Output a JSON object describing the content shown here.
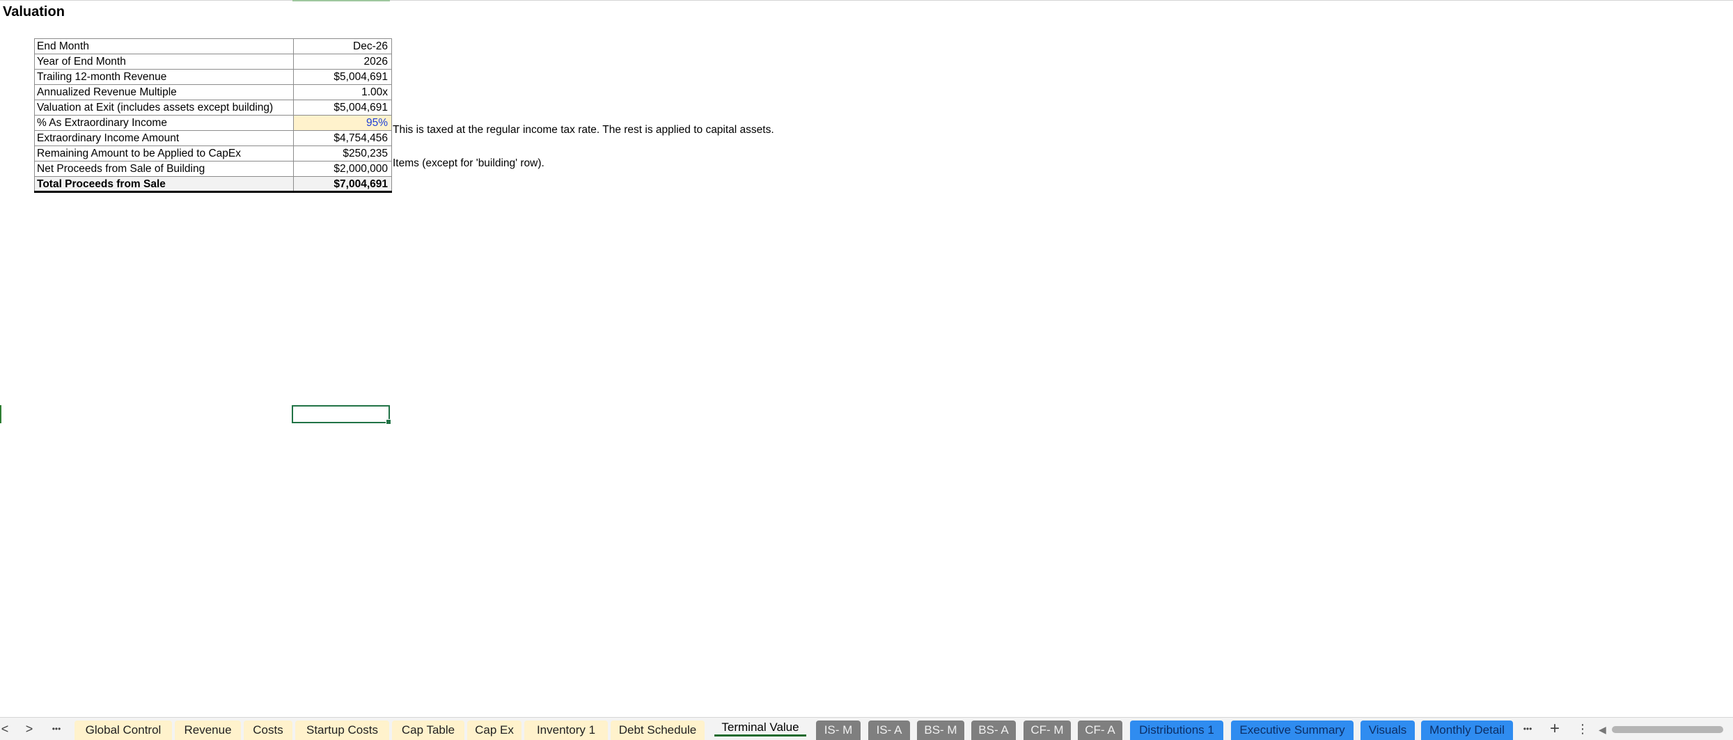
{
  "sheet": {
    "title": "Valuation",
    "rows": [
      {
        "label": "End Month",
        "value": "Dec-26"
      },
      {
        "label": "Year of End Month",
        "value": "2026"
      },
      {
        "label": "Trailing 12-month Revenue",
        "value": "$5,004,691"
      },
      {
        "label": "Annualized Revenue Multiple",
        "value": "1.00x"
      },
      {
        "label": "Valuation at Exit (includes assets except building)",
        "value": "$5,004,691"
      },
      {
        "label": "% As Extraordinary Income",
        "value": "95%"
      },
      {
        "label": "Extraordinary Income Amount",
        "value": "$4,754,456"
      },
      {
        "label": "Remaining Amount to be Applied to CapEx",
        "value": "$250,235"
      },
      {
        "label": "Net Proceeds from Sale of Building",
        "value": "$2,000,000"
      },
      {
        "label": "Total Proceeds from Sale",
        "value": "$7,004,691"
      }
    ],
    "notes": {
      "extraordinary_note": "This is taxed at the regular income tax rate. The rest is applied to capital assets.",
      "capex_note": "Items (except for 'building' row)."
    },
    "input_cell_fill": "#fff2cc",
    "input_text_color": "#1f3fd6"
  },
  "tabbar": {
    "nav_prev": "<",
    "nav_next": ">",
    "more_left": "•••",
    "more_right": "•••",
    "add_sheet": "+",
    "options": "⋮",
    "scroll_left": "◀",
    "active_tab": "Terminal Value",
    "tabs": [
      {
        "label": "Global Control",
        "color": "yellow"
      },
      {
        "label": "Revenue",
        "color": "yellow"
      },
      {
        "label": "Costs",
        "color": "yellow"
      },
      {
        "label": "Startup Costs",
        "color": "yellow"
      },
      {
        "label": "Cap Table",
        "color": "yellow"
      },
      {
        "label": "Cap Ex",
        "color": "yellow"
      },
      {
        "label": "Inventory 1",
        "color": "yellow"
      },
      {
        "label": "Debt Schedule",
        "color": "yellow"
      },
      {
        "label": "Terminal Value",
        "color": "none"
      },
      {
        "label": "IS- M",
        "color": "gray"
      },
      {
        "label": "IS- A",
        "color": "gray"
      },
      {
        "label": "BS- M",
        "color": "gray"
      },
      {
        "label": "BS- A",
        "color": "gray"
      },
      {
        "label": "CF- M",
        "color": "gray"
      },
      {
        "label": "CF- A",
        "color": "gray"
      },
      {
        "label": "Distributions 1",
        "color": "blue"
      },
      {
        "label": "Executive Summary",
        "color": "blue"
      },
      {
        "label": "Visuals",
        "color": "blue"
      },
      {
        "label": "Monthly Detail",
        "color": "blue"
      }
    ],
    "tab_colors": {
      "yellow": "#fff2cc",
      "gray": "#7f7f7f",
      "blue": "#2f8cf0"
    }
  }
}
